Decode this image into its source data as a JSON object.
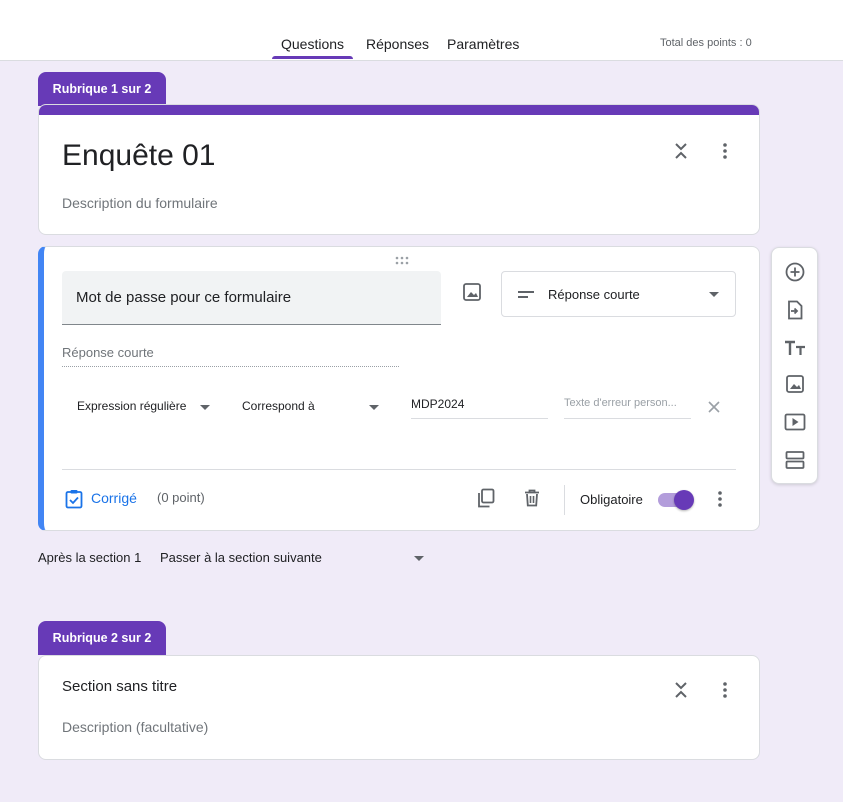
{
  "tabs": [
    {
      "label": "Questions",
      "active": true
    },
    {
      "label": "Réponses",
      "active": false
    },
    {
      "label": "Paramètres",
      "active": false
    }
  ],
  "total_points": "Total des points : 0",
  "accent_color": "#673ab7",
  "section1": {
    "tab_label": "Rubrique 1 sur 2",
    "form_title": "Enquête 01",
    "form_description": "Description du formulaire"
  },
  "question": {
    "title": "Mot de passe pour ce formulaire",
    "type": "Réponse courte",
    "answer_placeholder": "Réponse courte",
    "validation": {
      "kind": "Expression régulière",
      "condition": "Correspond à",
      "pattern": "MDP2024",
      "error_placeholder": "Texte d'erreur person..."
    },
    "answer_key_label": "Corrigé",
    "points": "(0 point)",
    "required_label": "Obligatoire",
    "required": true
  },
  "after_section": {
    "label": "Après la section 1",
    "value": "Passer à la section suivante"
  },
  "section2": {
    "tab_label": "Rubrique 2 sur 2",
    "title": "Section sans titre",
    "description": "Description (facultative)"
  },
  "icons": {
    "collapse": "collapse-icon",
    "more": "more-vert-icon",
    "drag": "drag-handle-icon",
    "image": "image-icon",
    "short_answer": "short-text-icon",
    "close": "close-icon",
    "answer_key": "clipboard-check-icon",
    "duplicate": "copy-icon",
    "delete": "trash-icon",
    "toolbar": [
      "add-circle-icon",
      "import-icon",
      "title-icon",
      "image-icon",
      "video-icon",
      "section-icon"
    ]
  }
}
